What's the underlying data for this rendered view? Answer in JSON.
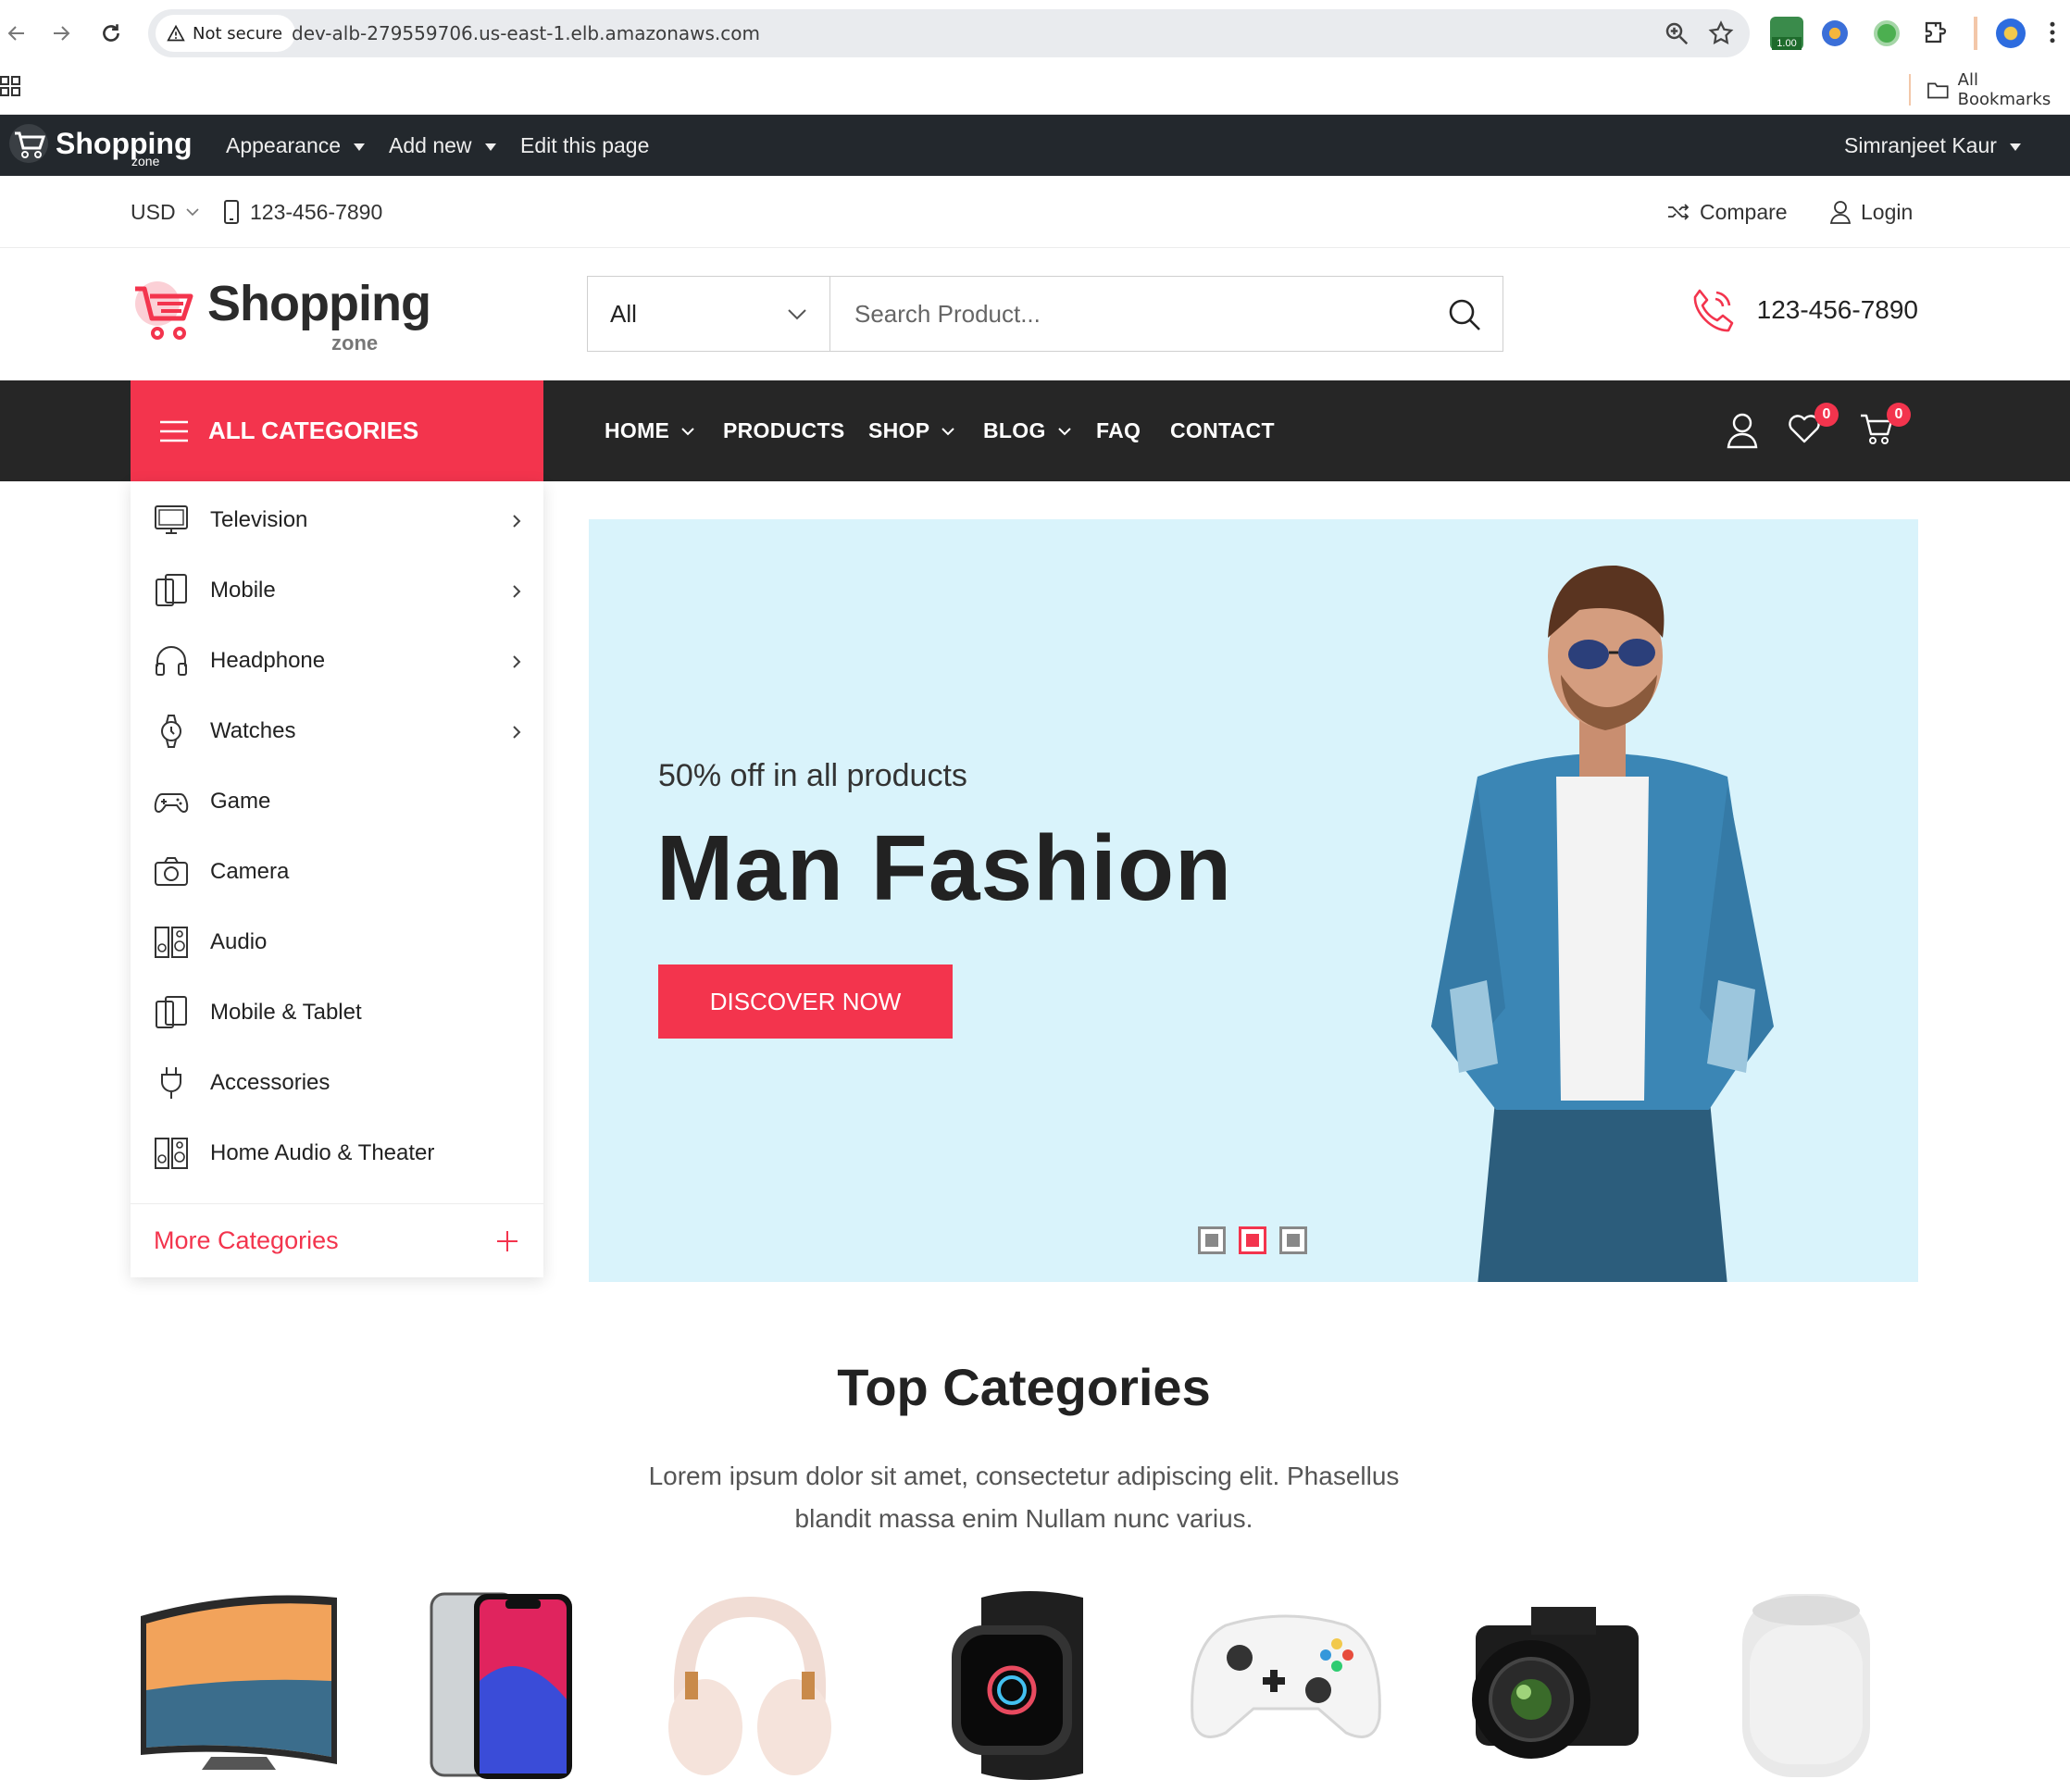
{
  "browser": {
    "security_label": "Not secure",
    "url": "dev-alb-279559706.us-east-1.elb.amazonaws.com",
    "extension_badge": "1.00",
    "bookmarks_label": "All Bookmarks"
  },
  "adminbar": {
    "site_name": "Shopping",
    "site_tagline": "zone",
    "items": [
      "Appearance",
      "Add new",
      "Edit this page"
    ],
    "user": "Simranjeet Kaur"
  },
  "topbar": {
    "currency": "USD",
    "phone": "123-456-7890",
    "compare": "Compare",
    "login": "Login"
  },
  "header": {
    "logo_text": "Shopping",
    "logo_tagline": "zone",
    "search_category": "All",
    "search_placeholder": "Search Product...",
    "hotline": "123-456-7890"
  },
  "nav": {
    "all_categories": "ALL CATEGORIES",
    "links": [
      {
        "label": "HOME",
        "dropdown": true
      },
      {
        "label": "PRODUCTS",
        "dropdown": false
      },
      {
        "label": "SHOP",
        "dropdown": true
      },
      {
        "label": "BLOG",
        "dropdown": true
      },
      {
        "label": "FAQ",
        "dropdown": false
      },
      {
        "label": "CONTACT",
        "dropdown": false
      }
    ],
    "wishlist_count": "0",
    "cart_count": "0"
  },
  "categories": {
    "items": [
      {
        "label": "Television",
        "icon": "television-icon",
        "submenu": true
      },
      {
        "label": "Mobile",
        "icon": "mobile-icon",
        "submenu": true
      },
      {
        "label": "Headphone",
        "icon": "headphone-icon",
        "submenu": true
      },
      {
        "label": "Watches",
        "icon": "watch-icon",
        "submenu": true
      },
      {
        "label": "Game",
        "icon": "gamepad-icon",
        "submenu": false
      },
      {
        "label": "Camera",
        "icon": "camera-icon",
        "submenu": false
      },
      {
        "label": "Audio",
        "icon": "speaker-icon",
        "submenu": false
      },
      {
        "label": "Mobile & Tablet",
        "icon": "tablet-icon",
        "submenu": false
      },
      {
        "label": "Accessories",
        "icon": "plug-icon",
        "submenu": false
      },
      {
        "label": "Home Audio & Theater",
        "icon": "speaker-icon",
        "submenu": false
      }
    ],
    "more": "More Categories"
  },
  "hero": {
    "subtitle": "50% off in all products",
    "title": "Man Fashion",
    "cta": "DISCOVER NOW",
    "slides": 3,
    "active_slide": 2
  },
  "top_categories": {
    "title": "Top Categories",
    "description": "Lorem ipsum dolor sit amet, consectetur adipiscing elit. Phasellus blandit massa enim Nullam nunc varius.",
    "products": [
      "tv-image",
      "smartphone-image",
      "headphones-image",
      "smartwatch-image",
      "game-controller-image",
      "camera-image",
      "smart-speaker-image"
    ]
  },
  "colors": {
    "accent": "#f3344d",
    "nav_bg": "#262626",
    "adminbar_bg": "#23282d",
    "hero_bg": "#d9f3fb"
  }
}
